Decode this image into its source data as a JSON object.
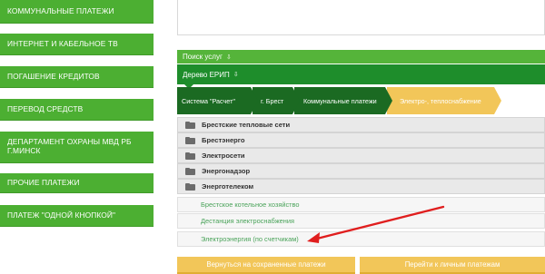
{
  "left_menu": {
    "items": [
      {
        "label": "Коммунальные платежи"
      },
      {
        "label": "Интернет и кабельное ТВ"
      },
      {
        "label": "Погашение кредитов"
      },
      {
        "label": "Перевод средств"
      },
      {
        "label": "Департамент охраны МВД РБ г.Минск"
      },
      {
        "label": "Прочие платежи"
      },
      {
        "label": "Платеж \"одной кнопкой\""
      }
    ]
  },
  "search": {
    "label": "Поиск услуг",
    "caret": "⇩"
  },
  "tree": {
    "label": "Дерево ЕРИП",
    "caret": "⇩"
  },
  "breadcrumb": [
    {
      "label": "Система \"Расчет\""
    },
    {
      "label": "г. Брест"
    },
    {
      "label": "Коммунальные платежи"
    },
    {
      "label": "Электро-, теплоснабжение"
    }
  ],
  "folders": [
    {
      "label": "Брестские тепловые сети"
    },
    {
      "label": "Брестэнерго"
    },
    {
      "label": "Электросети"
    },
    {
      "label": "Энергонадзор"
    },
    {
      "label": "Энерготелеком"
    }
  ],
  "links": [
    {
      "label": "Брестское котельное хозяйство"
    },
    {
      "label": "Дестанция электроснабжения"
    },
    {
      "label": "Электроэнергия (по счетчикам)"
    }
  ],
  "buttons": {
    "back": "Вернуться на сохраненные платежи",
    "personal": "Перейти к личным платежам"
  },
  "colors": {
    "menu_green": "#4caf32",
    "tree_green": "#1e8d2b",
    "breadcrumb_dark": "#1b6a22",
    "accent_yellow": "#f2c659",
    "link_green": "#4aa35a",
    "annotation_red": "#e01e1e"
  }
}
